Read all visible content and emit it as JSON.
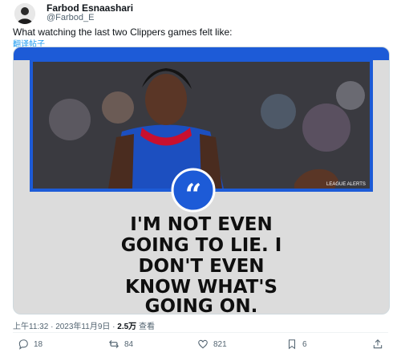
{
  "author": {
    "name": "Farbod Esnaashari",
    "handle": "@Farbod_E"
  },
  "tweet": {
    "text": "What watching the last two Clippers games felt like:",
    "translate_label": "翻译帖子"
  },
  "media": {
    "icon": "quote-icon",
    "watermark": "LEAGUE ALERTS",
    "quote_lines": [
      "I'M NOT EVEN",
      "GOING TO LIE. I",
      "DON'T EVEN",
      "KNOW WHAT'S",
      "GOING ON."
    ],
    "colors": {
      "banner": "#1d5bd7",
      "circle": "#1d5bd7",
      "text": "#0f0f0f",
      "panel": "#dcdcdc"
    }
  },
  "meta": {
    "time": "上午11:32",
    "date": "2023年11月9日",
    "views_count": "2.5万",
    "views_label": "查看"
  },
  "actions": {
    "replies": "18",
    "reposts": "84",
    "likes": "821",
    "bookmarks": "6"
  }
}
